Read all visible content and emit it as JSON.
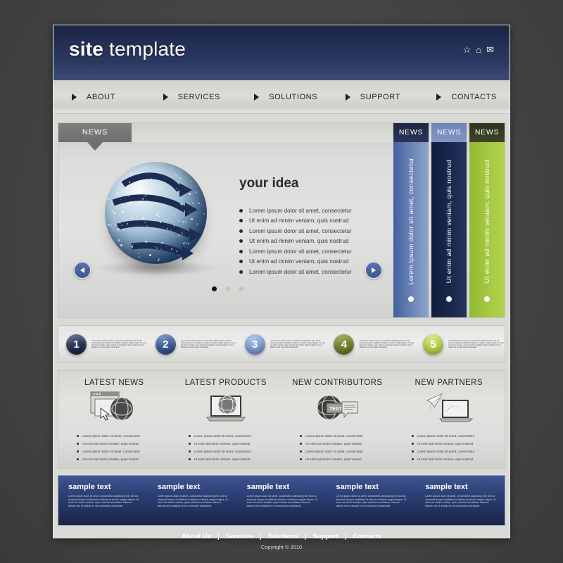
{
  "header": {
    "logo_bold": "site",
    "logo_light": " template",
    "icons": [
      {
        "name": "star-icon",
        "glyph": "☆"
      },
      {
        "name": "home-icon",
        "glyph": "⌂"
      },
      {
        "name": "mail-icon",
        "glyph": "✉"
      }
    ]
  },
  "nav": {
    "items": [
      {
        "label": "ABOUT"
      },
      {
        "label": "SERVICES"
      },
      {
        "label": "SOLUTIONS"
      },
      {
        "label": "SUPPORT"
      },
      {
        "label": "CONTACTS"
      }
    ]
  },
  "slider": {
    "tab_label": "NEWS",
    "title": "your idea",
    "bullets": [
      "Lorem ipsum dolor sit amet, consectetur",
      "Ut enim ad minim veniam, quis nostrud",
      "Lorem ipsum dolor sit amet, consectetur",
      "Ut enim ad minim veniam, quis nostrud",
      "Lorem ipsum dolor sit amet, consectetur",
      "Ut enim ad minim veniam, quis nostrud",
      "Lorem ipsum dolor sit amet, consectetur"
    ],
    "prev_label": "◀",
    "next_label": "▶",
    "pagination": {
      "total": 3,
      "active": 1
    },
    "ribbons": [
      {
        "cap": "NEWS",
        "text": "Lorem ipsum dolor sit amet, consectetur",
        "color": "#6f8bc4"
      },
      {
        "cap": "NEWS",
        "text": "Ut enim ad minim veniam, quis nostrud",
        "color": "#1b2b52"
      },
      {
        "cap": "NEWS",
        "text": "Ut enim ad minim veniam, quis nostrud",
        "color": "#a4c741"
      }
    ]
  },
  "steps": [
    {
      "number": "1",
      "color": "#1a2440",
      "text": "Lorem ipsum dolor sit amet, consectetur adipiscing elit, sed do eiusmod tempor incididunt ut labore et dolore magna aliqua. Ut enim ad minim veniam, quis nostrud exercitation ullamco laboris nisi ut aliquip ex ea commodo consequat."
    },
    {
      "number": "2",
      "color": "#2e4b86",
      "text": "Lorem ipsum dolor sit amet, consectetur adipiscing elit, sed do eiusmod tempor incididunt ut labore et dolore magna aliqua. Ut enim ad minim veniam, quis nostrud exercitation ullamco laboris nisi ut aliquip ex ea commodo consequat."
    },
    {
      "number": "3",
      "color": "#6f93cc",
      "text": "Lorem ipsum dolor sit amet, consectetur adipiscing elit, sed do eiusmod tempor incididunt ut labore et dolore magna aliqua. Ut enim ad minim veniam, quis nostrud exercitation ullamco laboris nisi ut aliquip ex ea commodo consequat."
    },
    {
      "number": "4",
      "color": "#6a7526",
      "text": "Lorem ipsum dolor sit amet, consectetur adipiscing elit, sed do eiusmod tempor incididunt ut labore et dolore magna aliqua. Ut enim ad minim veniam, quis nostrud exercitation ullamco laboris nisi ut aliquip ex ea commodo consequat."
    },
    {
      "number": "5",
      "color": "#b4d24a",
      "text": "Lorem ipsum dolor sit amet, consectetur adipiscing elit, sed do eiusmod tempor incididunt ut labore et dolore magna aliqua. Ut enim ad minim veniam, quis nostrud exercitation ullamco laboris nisi ut aliquip ex ea commodo consequat."
    }
  ],
  "columns": [
    {
      "title": "LATEST NEWS",
      "icon": "browser-globe-cursor-icon",
      "bullets": [
        "Lorem ipsum dolor sit amet, consectetur",
        "Ut enim ad minim veniam, quis nostrud",
        "Lorem ipsum dolor sit amet, consectetur",
        "Ut enim ad minim veniam, quis nostrud"
      ]
    },
    {
      "title": "LATEST PRODUCTS",
      "icon": "laptop-globe-icon",
      "bullets": [
        "Lorem ipsum dolor sit amet, consectetur",
        "Ut enim ad minim veniam, quis nostrud",
        "Lorem ipsum dolor sit amet, consectetur",
        "Ut enim ad minim veniam, quis nostrud"
      ]
    },
    {
      "title": "NEW CONTRIBUTORS",
      "icon": "globe-speech-bubble-icon",
      "bullets": [
        "Lorem ipsum dolor sit amet, consectetur",
        "Ut enim ad minim veniam, quis nostrud",
        "Lorem ipsum dolor sit amet, consectetur",
        "Ut enim ad minim veniam, quis nostrud"
      ]
    },
    {
      "title": "NEW PARTNERS",
      "icon": "paper-plane-laptop-icon",
      "bullets": [
        "Lorem ipsum dolor sit amet, consectetur",
        "Ut enim ad minim veniam, quis nostrud",
        "Lorem ipsum dolor sit amet, consectetur",
        "Ut enim ad minim veniam, quis nostrud"
      ]
    }
  ],
  "band": [
    {
      "title": "sample text",
      "text": "Lorem ipsum dolor sit amet, consectetur adipiscing elit, sed do eiusmod tempor incididunt ut labore et dolore magna aliqua. Ut enim ad minim veniam, quis nostrud exercitation ullamco laboris nisi ut aliquip ex ea commodo consequat."
    },
    {
      "title": "sample text",
      "text": "Lorem ipsum dolor sit amet, consectetur adipiscing elit, sed do eiusmod tempor incididunt ut labore et dolore magna aliqua. Ut enim ad minim veniam, quis nostrud exercitation ullamco laboris nisi ut aliquip ex ea commodo consequat."
    },
    {
      "title": "sample text",
      "text": "Lorem ipsum dolor sit amet, consectetur adipiscing elit, sed do eiusmod tempor incididunt ut labore et dolore magna aliqua. Ut enim ad minim veniam, quis nostrud exercitation ullamco laboris nisi ut aliquip ex ea commodo consequat."
    },
    {
      "title": "sample text",
      "text": "Lorem ipsum dolor sit amet, consectetur adipiscing elit, sed do eiusmod tempor incididunt ut labore et dolore magna aliqua. Ut enim ad minim veniam, quis nostrud exercitation ullamco laboris nisi ut aliquip ex ea commodo consequat."
    },
    {
      "title": "sample text",
      "text": "Lorem ipsum dolor sit amet, consectetur adipiscing elit, sed do eiusmod tempor incididunt ut labore et dolore magna aliqua. Ut enim ad minim veniam, quis nostrud exercitation ullamco laboris nisi ut aliquip ex ea commodo consequat."
    }
  ],
  "footer": {
    "links": [
      "About Us",
      "Services",
      "Solutions",
      "Support",
      "Contacts"
    ],
    "separator": "|",
    "copyright": "Copyright © 2010"
  }
}
